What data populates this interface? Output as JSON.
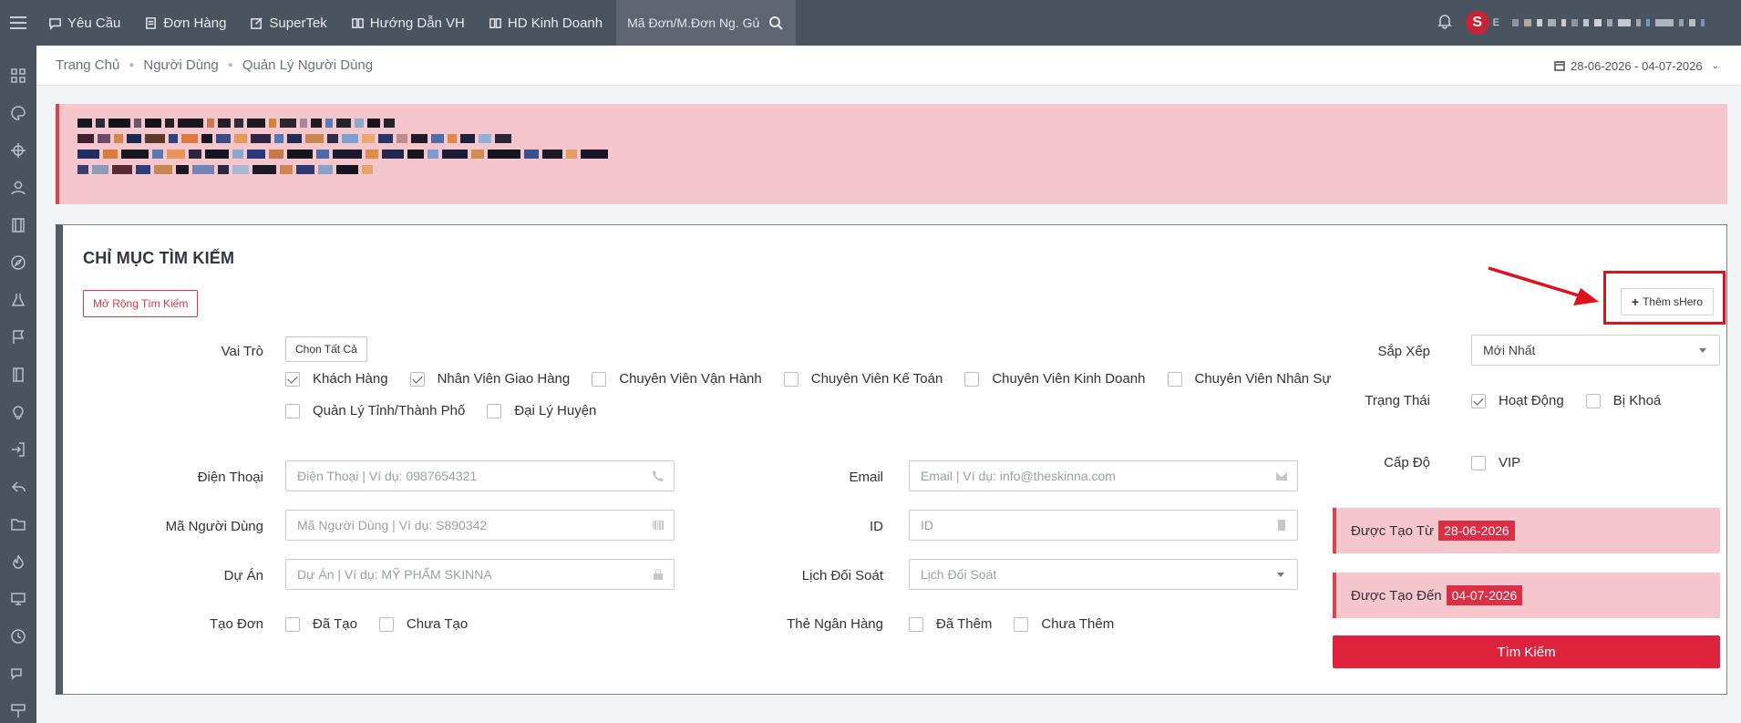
{
  "topbar": {
    "nav": [
      {
        "label": "Yêu Cầu",
        "icon": "chat-icon"
      },
      {
        "label": "Đơn Hàng",
        "icon": "receipt-icon"
      },
      {
        "label": "SuperTek",
        "icon": "edit-icon"
      },
      {
        "label": "Hướng Dẫn VH",
        "icon": "book-icon"
      },
      {
        "label": "HD Kinh Doanh",
        "icon": "book-icon"
      }
    ],
    "search_placeholder": "Mã Đơn/M.Đơn Ng. Gử",
    "avatar_letter": "S",
    "user_initial": "E"
  },
  "breadcrumb": [
    "Trang Chủ",
    "Người Dùng",
    "Quản Lý Người Dùng"
  ],
  "daterange": "28-06-2026 - 04-07-2026",
  "card": {
    "title": "CHỈ MỤC TÌM KIẾM",
    "expand_button": "Mở Rộng Tìm Kiếm",
    "add_button": "Thêm sHero",
    "role": {
      "label": "Vai Trò",
      "select_all": "Chọn Tất Cả",
      "options": [
        {
          "label": "Khách Hàng",
          "checked": true
        },
        {
          "label": "Nhân Viên Giao Hàng",
          "checked": true
        },
        {
          "label": "Chuyên Viên Vận Hành",
          "checked": false
        },
        {
          "label": "Chuyên Viên Kế Toán",
          "checked": false
        },
        {
          "label": "Chuyên Viên Kinh Doanh",
          "checked": false
        },
        {
          "label": "Chuyên Viên Nhân Sự",
          "checked": false
        },
        {
          "label": "Quản Lý Tỉnh/Thành Phố",
          "checked": false
        },
        {
          "label": "Đại Lý Huyện",
          "checked": false
        }
      ]
    },
    "phone": {
      "label": "Điện Thoại",
      "placeholder": "Điện Thoại | Ví dụ: 0987654321"
    },
    "user_code": {
      "label": "Mã Người Dùng",
      "placeholder": "Mã Người Dùng | Ví dụ: S890342"
    },
    "project": {
      "label": "Dự Án",
      "placeholder": "Dự Án | Ví dụ: MỸ PHẨM SKINNA"
    },
    "create_order": {
      "label": "Tạo Đơn",
      "options": [
        "Đã Tạo",
        "Chưa Tạo"
      ]
    },
    "email": {
      "label": "Email",
      "placeholder": "Email | Ví dụ: info@theskinna.com"
    },
    "id": {
      "label": "ID",
      "placeholder": "ID"
    },
    "reconcile": {
      "label": "Lịch Đối Soát",
      "placeholder": "Lịch Đối Soát"
    },
    "bank_card": {
      "label": "Thẻ Ngân Hàng",
      "options": [
        "Đã Thêm",
        "Chưa Thêm"
      ]
    },
    "sort": {
      "label": "Sắp Xếp",
      "value": "Mới Nhất"
    },
    "status": {
      "label": "Trạng Thái",
      "options": [
        {
          "label": "Hoạt Động",
          "checked": true
        },
        {
          "label": "Bị Khoá",
          "checked": false
        }
      ]
    },
    "level": {
      "label": "Cấp Độ",
      "option": "VIP"
    },
    "created_from": {
      "label": "Được Tạo Từ",
      "value": "28-06-2026"
    },
    "created_to": {
      "label": "Được Tạo Đến",
      "value": "04-07-2026"
    },
    "search_button": "Tìm Kiếm"
  },
  "colors": {
    "accent": "#e0233c",
    "navbar": "#4a5360",
    "alert_bg": "#f5c6cb"
  }
}
